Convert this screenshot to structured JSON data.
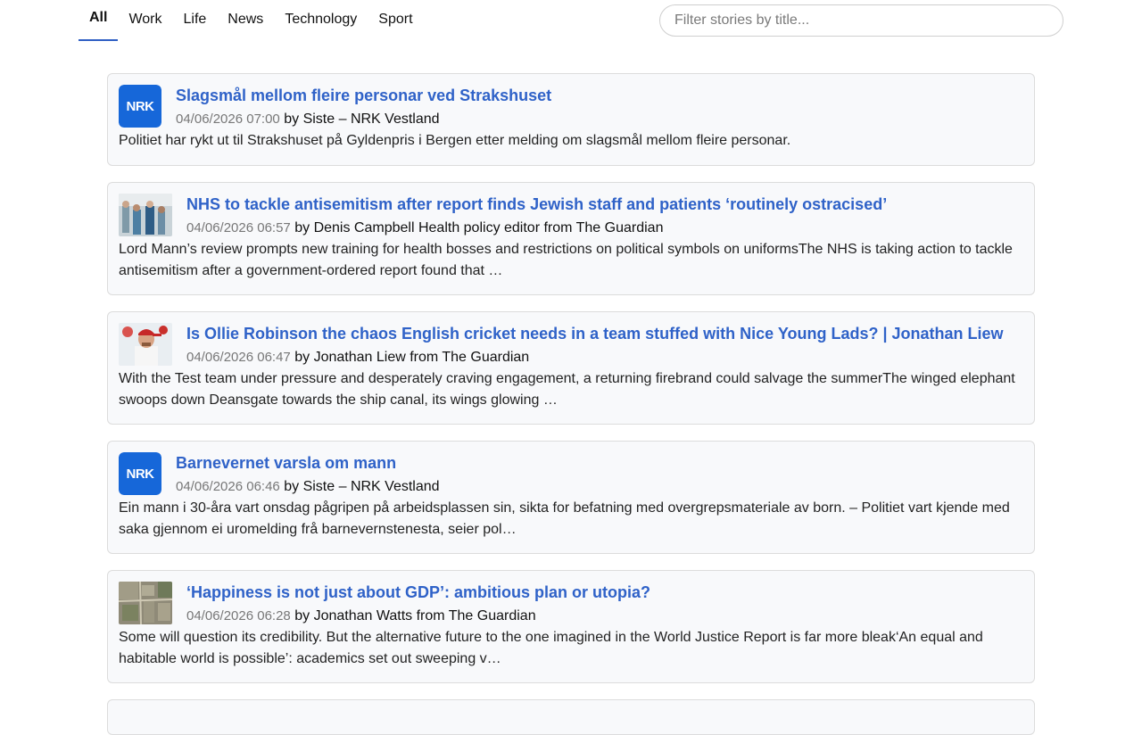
{
  "tabs": [
    {
      "label": "All",
      "active": true
    },
    {
      "label": "Work"
    },
    {
      "label": "Life"
    },
    {
      "label": "News"
    },
    {
      "label": "Technology"
    },
    {
      "label": "Sport"
    }
  ],
  "search": {
    "placeholder": "Filter stories by title..."
  },
  "stories": [
    {
      "title": "Slagsmål mellom fleire personar ved Strakshuset",
      "date": "04/06/2026 07:00",
      "by": "by Siste – NRK Vestland",
      "description": "Politiet har rykt ut til Strakshuset på Gyldenpris i Bergen etter melding om slagsmål mellom fleire personar.",
      "thumb": "nrk-logo",
      "logo_text": "NRK"
    },
    {
      "title": "NHS to tackle antisemitism after report finds Jewish staff and patients ‘routinely ostracised’",
      "date": "04/06/2026 06:57",
      "by": "by Denis Campbell Health policy editor from The Guardian",
      "description": "Lord Mann’s review prompts new training for health bosses and restrictions on political symbols on uniformsThe NHS is taking action to tackle antisemitism after a government-ordered report found that …",
      "thumb": "hospital-photo"
    },
    {
      "title": "Is Ollie Robinson the chaos English cricket needs in a team stuffed with Nice Young Lads? | Jonathan Liew",
      "date": "04/06/2026 06:47",
      "by": "by Jonathan Liew from The Guardian",
      "description": "With the Test team under pressure and desperately craving engagement, a returning firebrand could salvage the summerThe winged elephant swoops down Deansgate towards the ship canal, its wings glowing …",
      "thumb": "cricketer-photo"
    },
    {
      "title": "Barnevernet varsla om mann",
      "date": "04/06/2026 06:46",
      "by": "by Siste – NRK Vestland",
      "description": "Ein mann i 30-åra vart onsdag pågripen på arbeidsplassen sin, sikta for befatning med overgrepsmateriale av born. – Politiet vart kjende med saka gjennom ei uromelding frå barnevernstenesta, seier pol…",
      "thumb": "nrk-logo",
      "logo_text": "NRK"
    },
    {
      "title": "‘Happiness is not just about GDP’: ambitious plan or utopia?",
      "date": "04/06/2026 06:28",
      "by": "by Jonathan Watts from The Guardian",
      "description": "Some will question its credibility. But the alternative future to the one imagined in the World Justice Report is far more bleak‘An equal and habitable world is possible’: academics set out sweeping v…",
      "thumb": "aerial-city-photo"
    }
  ],
  "colors": {
    "accent": "#2f5fc4",
    "link": "#2f62c8",
    "nrk_blue": "#1667d9",
    "card_bg": "#f8f9fb"
  }
}
